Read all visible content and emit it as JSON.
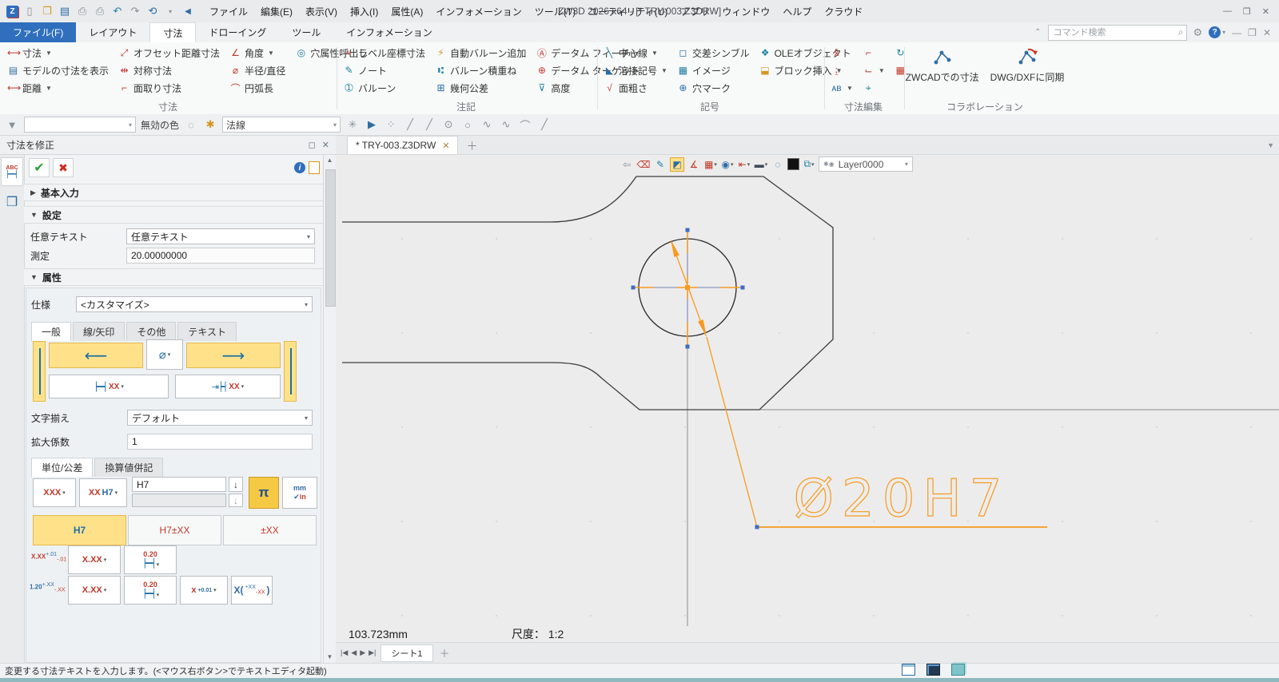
{
  "titlebar": {
    "title": "ZW3D 2026 x64  - [* TRY-003.Z3DRW]",
    "menus": [
      "ファイル",
      "編集(E)",
      "表示(V)",
      "挿入(I)",
      "属性(A)",
      "インフォメーション",
      "ツール(T)",
      "ユーティリティ(U)",
      "アプリ",
      "ウィンドウ",
      "ヘルプ",
      "クラウド"
    ]
  },
  "ribbon": {
    "file_tab": "ファイル(F)",
    "tabs": [
      "レイアウト",
      "寸法",
      "ドローイング",
      "ツール",
      "インフォメーション"
    ],
    "active_tab": "寸法",
    "search_placeholder": "コマンド検索",
    "groups": [
      {
        "label": "寸法",
        "cols": [
          [
            {
              "t": "寸法",
              "icon": "dim",
              "arrow": true
            },
            {
              "t": "モデルの寸法を表示",
              "icon": "modeldim"
            },
            {
              "t": "距離",
              "icon": "distance",
              "arrow": true
            }
          ],
          [
            {
              "t": "オフセット距離寸法",
              "icon": "offset"
            },
            {
              "t": "対称寸法",
              "icon": "symmetric"
            },
            {
              "t": "面取り寸法",
              "icon": "chamfer"
            }
          ],
          [
            {
              "t": "角度",
              "icon": "angle",
              "arrow": true
            },
            {
              "t": "半径/直径",
              "icon": "radius"
            },
            {
              "t": "円弧長",
              "icon": "arclen"
            }
          ],
          [
            {
              "t": "穴属性呼出し",
              "icon": "holeattr"
            },
            null,
            null
          ]
        ]
      },
      {
        "label": "注記",
        "cols": [
          [
            {
              "t": "ラベル座標寸法",
              "icon": "labelcoord"
            },
            {
              "t": "ノート",
              "icon": "note"
            },
            {
              "t": "バルーン",
              "icon": "balloon"
            }
          ],
          [
            {
              "t": "自動バルーン追加",
              "icon": "autoballoon"
            },
            {
              "t": "バルーン積重ね",
              "icon": "stack"
            },
            {
              "t": "幾何公差",
              "icon": "gtol"
            }
          ],
          [
            {
              "t": "データム フィーチャ",
              "icon": "datumf"
            },
            {
              "t": "データム ターゲット",
              "icon": "datumt"
            },
            {
              "t": "高度",
              "icon": "elev"
            }
          ]
        ]
      },
      {
        "label": "記号",
        "cols": [
          [
            {
              "t": "中心線",
              "icon": "centerline",
              "arrow": true
            },
            {
              "t": "溶接記号",
              "icon": "weld",
              "arrow": true
            },
            {
              "t": "面粗さ",
              "icon": "rough"
            }
          ],
          [
            {
              "t": "交差シンブル",
              "icon": "intersect"
            },
            {
              "t": "イメージ",
              "icon": "image"
            },
            {
              "t": "穴マーク",
              "icon": "holemark"
            }
          ],
          [
            {
              "t": "OLEオブジェクト",
              "icon": "ole"
            },
            {
              "t": "ブロック挿入",
              "icon": "block",
              "arrow": true
            },
            null
          ]
        ]
      },
      {
        "label": "寸法編集",
        "cols": [
          [
            {
              "t": "",
              "icon": "xxedit"
            },
            {
              "t": "",
              "icon": "t50"
            },
            {
              "t": "",
              "icon": "abcedit",
              "arrow": true
            }
          ],
          [
            {
              "t": "",
              "icon": "dimp"
            },
            {
              "t": "",
              "icon": "dimh",
              "arrow": true
            },
            {
              "t": "",
              "icon": "tgt"
            }
          ],
          [
            {
              "t": "",
              "icon": "crv"
            },
            {
              "t": "",
              "icon": "pat"
            },
            null
          ]
        ]
      },
      {
        "label": "コラボレーション",
        "big": true,
        "buttons": [
          "ZWCADでの寸法",
          "DWG/DXFに同期"
        ]
      }
    ]
  },
  "quickbar": {
    "disabled_color": "無効の色",
    "line_style": "法線"
  },
  "panel": {
    "title": "寸法を修正",
    "basic": "基本入力",
    "settings": "設定",
    "attributes": "属性",
    "any_text_label": "任意テキスト",
    "any_text_value": "任意テキスト",
    "measure_label": "測定",
    "measure_value": "20.00000000",
    "spec_label": "仕様",
    "spec_value": "<カスタマイズ>",
    "attr_tabs": [
      "一般",
      "線/矢印",
      "その他",
      "テキスト"
    ],
    "attr_active_tab": "一般",
    "align_label": "文字揃え",
    "align_value": "デフォルト",
    "scale_label": "拡大係数",
    "scale_value": "1",
    "unit_tabs": [
      "単位/公差",
      "換算値併記"
    ],
    "unit_active_tab": "単位/公差",
    "fmt1": "XXX",
    "fmt2a": "XX",
    "fmt2b": "H7",
    "fit_input": "H7",
    "tol_buttons": [
      "H7",
      "H7±XX",
      "±XX"
    ],
    "tol_active": "H7",
    "combo_xx": "X.XX",
    "combo_020": "0.20",
    "row1_main": "X.XX",
    "row1_sup": "+.01",
    "row1_sub": "-.01",
    "row2_main": "1.20",
    "row2_sup": "+.XX",
    "row2_sub": "-.XX",
    "x_combo_main": "x",
    "x_combo_sup": "+0.01",
    "paren_open": "X(",
    "paren_sup": "+XX",
    "paren_sub": "-XX",
    "paren_close": ")"
  },
  "doc": {
    "tab": "* TRY-003.Z3DRW"
  },
  "canvas": {
    "layer": "Layer0000",
    "dim_text": "Ø20H7",
    "readout": "103.723mm",
    "scale_label": "尺度：",
    "scale_value": "1:2",
    "sheet": "シート1"
  },
  "statusbar": {
    "message": "変更する寸法テキストを入力します。(<マウス右ボタン>でテキストエディタ起動)"
  }
}
